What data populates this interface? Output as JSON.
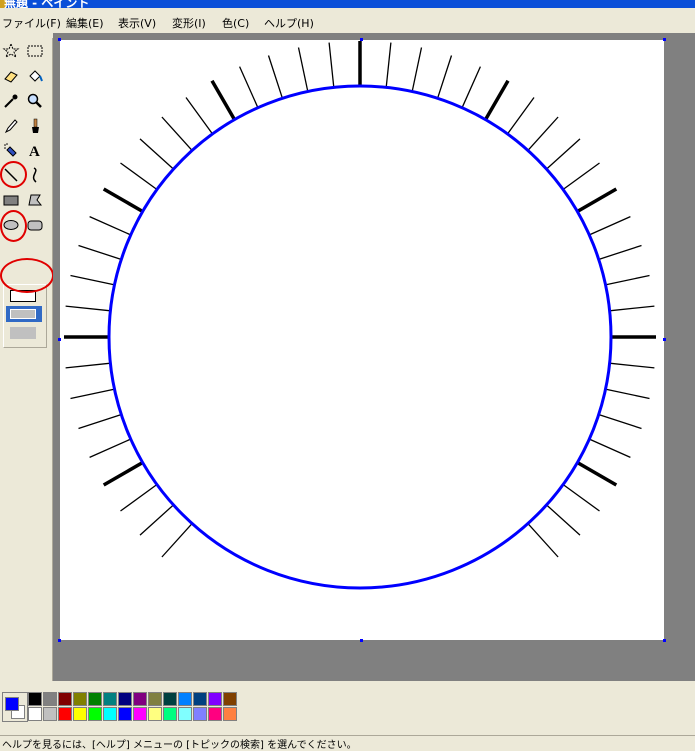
{
  "window": {
    "title": "無題 - ペイント"
  },
  "menu": [
    "ファイル(F)",
    "編集(E)",
    "表示(V)",
    "変形(I)",
    "色(C)",
    "ヘルプ(H)"
  ],
  "tools": [
    {
      "name": "free-select-tool",
      "icon": "star-select-icon"
    },
    {
      "name": "rect-select-tool",
      "icon": "dashed-rect-icon"
    },
    {
      "name": "eraser-tool",
      "icon": "eraser-icon"
    },
    {
      "name": "fill-tool",
      "icon": "paint-bucket-icon"
    },
    {
      "name": "color-picker-tool",
      "icon": "eyedropper-icon"
    },
    {
      "name": "magnifier-tool",
      "icon": "magnifier-icon"
    },
    {
      "name": "pencil-tool",
      "icon": "pencil-icon"
    },
    {
      "name": "brush-tool",
      "icon": "brush-icon"
    },
    {
      "name": "airbrush-tool",
      "icon": "airbrush-icon"
    },
    {
      "name": "text-tool",
      "icon": "text-a-icon"
    },
    {
      "name": "line-tool",
      "icon": "line-icon"
    },
    {
      "name": "curve-tool",
      "icon": "curve-icon"
    },
    {
      "name": "rectangle-tool",
      "icon": "rectangle-icon"
    },
    {
      "name": "polygon-tool",
      "icon": "polygon-icon"
    },
    {
      "name": "ellipse-tool",
      "icon": "ellipse-icon"
    },
    {
      "name": "rounded-rect-tool",
      "icon": "rounded-rect-icon"
    }
  ],
  "colors": {
    "foreground": "#0000ff",
    "background": "#ffffff",
    "palette_top": [
      "#000000",
      "#808080",
      "#800000",
      "#808000",
      "#008000",
      "#008080",
      "#000080",
      "#800080",
      "#808040",
      "#004040",
      "#0080ff",
      "#004080",
      "#8000ff",
      "#804000"
    ],
    "palette_bottom": [
      "#ffffff",
      "#c0c0c0",
      "#ff0000",
      "#ffff00",
      "#00ff00",
      "#00ffff",
      "#0000ff",
      "#ff00ff",
      "#ffff80",
      "#00ff80",
      "#80ffff",
      "#8080ff",
      "#ff0080",
      "#ff8040"
    ],
    "circle_stroke": "#0000ff",
    "annotation": "#e00000"
  },
  "status": {
    "text": "ヘルプを見るには、[ヘルプ] メニューの [トピックの検索] を選んでください。"
  }
}
